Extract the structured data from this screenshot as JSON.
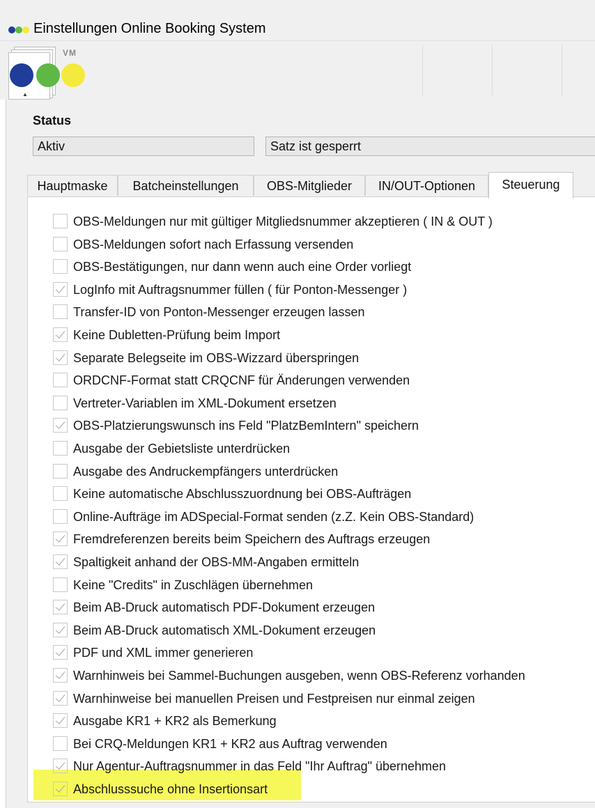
{
  "window": {
    "title": "Einstellungen Online Booking System",
    "icon": "app-dots-icon"
  },
  "colors": {
    "dot_blue": "#1f3d99",
    "dot_green": "#5fb746",
    "dot_yellow": "#f4ea3d",
    "highlight": "#f6f85a"
  },
  "logo": {
    "text": "VM"
  },
  "status": {
    "label": "Status",
    "field1": "Aktiv",
    "field2": "Satz ist gesperrt"
  },
  "tabs": [
    {
      "label": "Hauptmaske",
      "active": false
    },
    {
      "label": "Batcheinstellungen",
      "active": false
    },
    {
      "label": "OBS-Mitglieder",
      "active": false
    },
    {
      "label": "IN/OUT-Optionen",
      "active": false
    },
    {
      "label": "Steuerung",
      "active": true
    }
  ],
  "options": [
    {
      "label": "OBS-Meldungen nur mit gültiger Mitgliedsnummer akzeptieren ( IN & OUT )",
      "checked": false
    },
    {
      "label": "OBS-Meldungen sofort nach Erfassung versenden",
      "checked": false
    },
    {
      "label": "OBS-Bestätigungen, nur dann wenn auch eine Order vorliegt",
      "checked": false
    },
    {
      "label": "LogInfo mit Auftragsnummer füllen ( für Ponton-Messenger )",
      "checked": true
    },
    {
      "label": "Transfer-ID von Ponton-Messenger erzeugen lassen",
      "checked": false
    },
    {
      "label": "Keine Dubletten-Prüfung beim Import",
      "checked": true
    },
    {
      "label": "Separate Belegseite im OBS-Wizzard überspringen",
      "checked": true
    },
    {
      "label": "ORDCNF-Format statt CRQCNF für Änderungen verwenden",
      "checked": false
    },
    {
      "label": "Vertreter-Variablen im XML-Dokument ersetzen",
      "checked": false
    },
    {
      "label": "OBS-Platzierungswunsch ins Feld \"PlatzBemIntern\" speichern",
      "checked": true
    },
    {
      "label": "Ausgabe der Gebietsliste unterdrücken",
      "checked": false
    },
    {
      "label": "Ausgabe des Andruckempfängers unterdrücken",
      "checked": false
    },
    {
      "label": "Keine automatische Abschlusszuordnung bei OBS-Aufträgen",
      "checked": false
    },
    {
      "label": "Online-Aufträge im ADSpecial-Format senden (z.Z. Kein OBS-Standard)",
      "checked": false
    },
    {
      "label": "Fremdreferenzen bereits beim Speichern des Auftrags erzeugen",
      "checked": true
    },
    {
      "label": "Spaltigkeit anhand der OBS-MM-Angaben ermitteln",
      "checked": true
    },
    {
      "label": "Keine \"Credits\" in Zuschlägen übernehmen",
      "checked": false
    },
    {
      "label": "Beim AB-Druck automatisch PDF-Dokument erzeugen",
      "checked": true
    },
    {
      "label": "Beim AB-Druck automatisch XML-Dokument erzeugen",
      "checked": true
    },
    {
      "label": "PDF und XML immer generieren",
      "checked": true
    },
    {
      "label": "Warnhinweis bei Sammel-Buchungen ausgeben, wenn OBS-Referenz vorhanden",
      "checked": true
    },
    {
      "label": "Warnhinweise bei manuellen Preisen und Festpreisen nur einmal zeigen",
      "checked": true
    },
    {
      "label": "Ausgabe KR1 + KR2 als Bemerkung",
      "checked": true
    },
    {
      "label": "Bei CRQ-Meldungen KR1 + KR2 aus Auftrag verwenden",
      "checked": false
    },
    {
      "label": "Nur Agentur-Auftragsnummer in das Feld \"Ihr Auftrag\" übernehmen",
      "checked": true
    },
    {
      "label": "Abschlusssuche ohne Insertionsart",
      "checked": true,
      "highlighted": true
    }
  ]
}
